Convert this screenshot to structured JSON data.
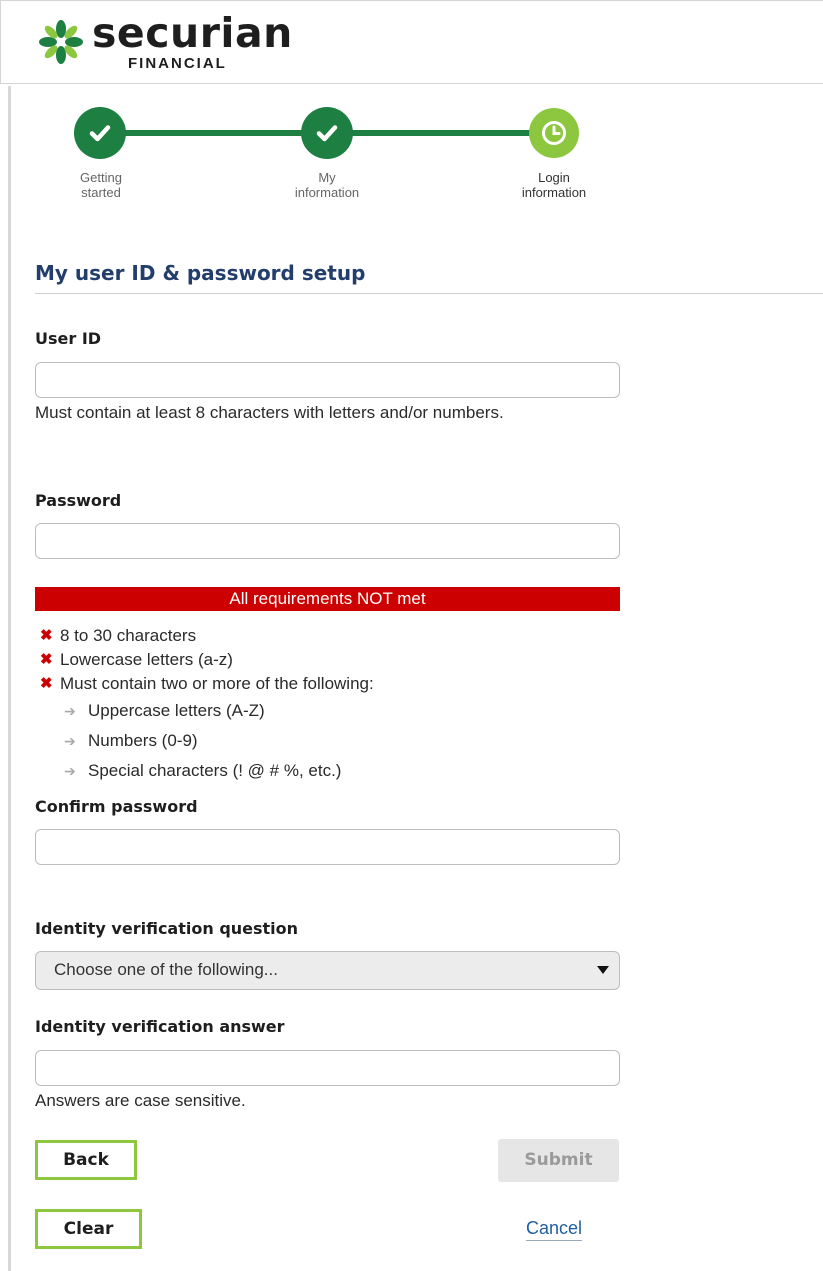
{
  "brand": {
    "name": "securian",
    "subname": "FINANCIAL",
    "colors": {
      "dark_green": "#1d7f41",
      "light_green": "#8dc63f",
      "navy": "#233e6b",
      "error_red": "#cc0000"
    }
  },
  "stepper": {
    "steps": [
      {
        "label_line1": "Getting",
        "label_line2": "started",
        "state": "complete",
        "icon": "check-icon"
      },
      {
        "label_line1": "My",
        "label_line2": "information",
        "state": "complete",
        "icon": "check-icon"
      },
      {
        "label_line1": "Login",
        "label_line2": "information",
        "state": "current",
        "icon": "clock-icon"
      }
    ]
  },
  "form": {
    "title": "My user ID & password setup",
    "user_id": {
      "label": "User ID",
      "value": "",
      "help": "Must contain at least 8 characters with letters and/or numbers."
    },
    "password": {
      "label": "Password",
      "value": "",
      "status_banner": "All requirements NOT met",
      "requirements": [
        "8 to 30 characters",
        "Lowercase letters (a-z)",
        "Must contain two or more of the following:"
      ],
      "sub_requirements": [
        "Uppercase letters (A-Z)",
        "Numbers (0-9)",
        "Special characters (! @ # %, etc.)"
      ]
    },
    "confirm_password": {
      "label": "Confirm password",
      "value": ""
    },
    "question": {
      "label": "Identity verification question",
      "selected": "Choose one of the following..."
    },
    "answer": {
      "label": "Identity verification answer",
      "value": "",
      "help": "Answers are case sensitive."
    }
  },
  "actions": {
    "back": "Back",
    "submit": "Submit",
    "clear": "Clear",
    "cancel": "Cancel"
  }
}
